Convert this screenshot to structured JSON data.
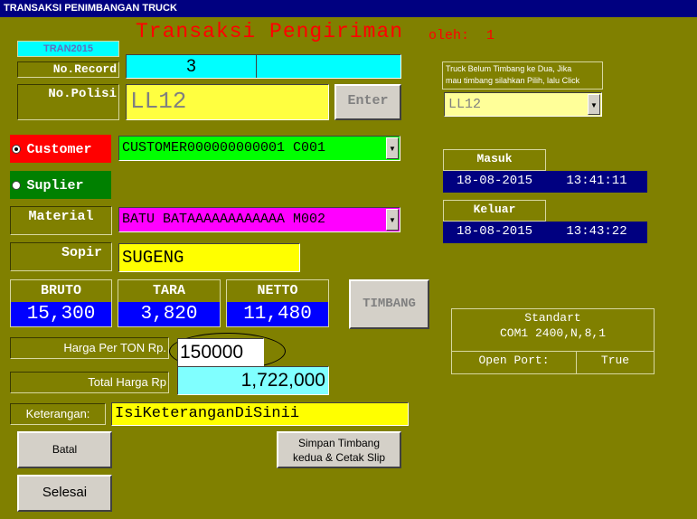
{
  "window": {
    "title": "TRANSAKSI PENIMBANGAN TRUCK"
  },
  "header": {
    "title": "Transaksi Pengiriman",
    "by_label": "oleh:",
    "by_value": "1"
  },
  "form": {
    "code": "TRAN2015",
    "record_label": "No.Record",
    "record_value": "3",
    "polisi_label": "No.Polisi",
    "polisi_value": "LL12",
    "enter_label": "Enter",
    "customer_label": "Customer",
    "customer_selected": true,
    "customer_value": "CUSTOMER000000000001 C001",
    "suplier_label": "Suplier",
    "material_label": "Material",
    "material_value": "BATU BATAAAAAAAAAAAA M002",
    "sopir_label": "Sopir",
    "sopir_value": "SUGENG",
    "harga_label": "Harga Per TON Rp.",
    "harga_value": "150000",
    "total_label": "Total Harga Rp",
    "total_value": "1,722,000",
    "keterangan_label": "Keterangan:",
    "keterangan_value": "IsiKeteranganDiSinii"
  },
  "weights": {
    "bruto_label": "BRUTO",
    "bruto_value": "15,300",
    "tara_label": "TARA",
    "tara_value": "3,820",
    "netto_label": "NETTO",
    "netto_value": "11,480",
    "timbang_label": "TIMBANG"
  },
  "truck_panel": {
    "hint_line1": "Truck Belum Timbang ke Dua, Jika",
    "hint_line2": "mau timbang silahkan Pilih, lalu Click",
    "selected": "LL12"
  },
  "times": {
    "masuk_label": "Masuk",
    "masuk_date": "18-08-2015",
    "masuk_time": "13:41:11",
    "keluar_label": "Keluar",
    "keluar_date": "18-08-2015",
    "keluar_time": "13:43:22"
  },
  "port": {
    "standard_label": "Standart",
    "config": "COM1 2400,N,8,1",
    "open_label": "Open Port:",
    "open_value": "True"
  },
  "buttons": {
    "batal": "Batal",
    "simpan_line1": "Simpan Timbang",
    "simpan_line2": "kedua & Cetak Slip",
    "selesai": "Selesai"
  }
}
